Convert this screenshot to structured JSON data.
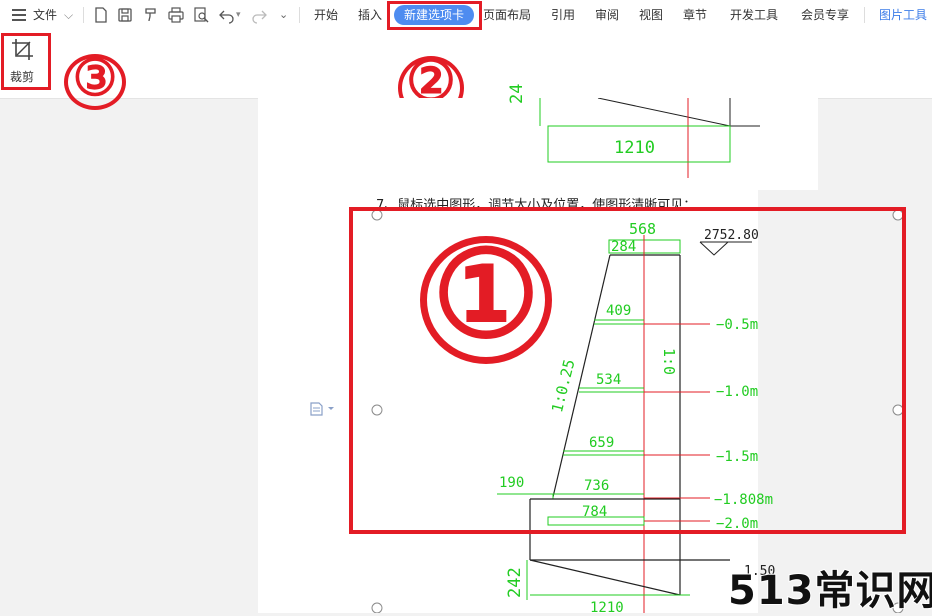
{
  "toolbar": {
    "file_label": "文件",
    "tabs": [
      "开始",
      "插入",
      "新建选项卡",
      "页面布局",
      "引用",
      "审阅",
      "视图",
      "章节",
      "开发工具",
      "会员专享",
      "图片工具"
    ],
    "active_tab": "新建选项卡"
  },
  "ribbon": {
    "crop_label": "裁剪"
  },
  "annotations": {
    "one": "①",
    "two": "②",
    "three": "③"
  },
  "document": {
    "instruction": "7、鼠标选中图形，调节大小及位置，使图形清晰可见："
  },
  "drawing": {
    "top_width": "568",
    "top_inner": "284",
    "elevation": "2752.80",
    "levels": [
      "409",
      "534",
      "659",
      "736",
      "784"
    ],
    "depths": [
      "−0.5m",
      "−1.0m",
      "−1.5m",
      "−1.808m",
      "−2.0m"
    ],
    "slope_left": "1:0.25",
    "slope_right": "1:0",
    "toe": "190",
    "base_top_width": "1210",
    "base_top_height": "24",
    "base_bottom_height": "242",
    "base_bottom_width": "1210",
    "bottom_elevation": "1.50"
  },
  "watermark": "513常识网",
  "colors": {
    "accent": "#4e8cf0",
    "annotation_red": "#e31c25",
    "cad_green": "#22cc22",
    "cad_red": "#e31c25"
  }
}
